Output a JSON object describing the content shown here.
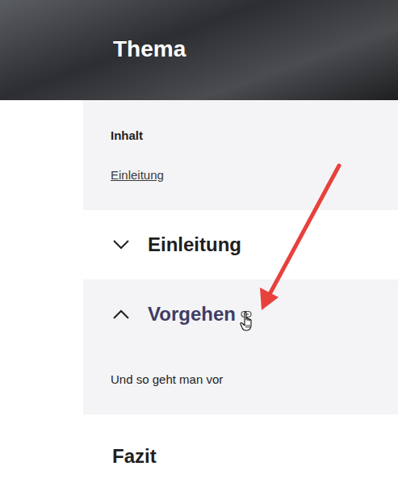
{
  "header": {
    "title": "Thema"
  },
  "toc": {
    "title": "Inhalt",
    "items": [
      {
        "label": "Einleitung"
      }
    ]
  },
  "sections": [
    {
      "title": "Einleitung",
      "kind": "accordion",
      "expanded": false,
      "hovered": false,
      "body": ""
    },
    {
      "title": "Vorgehen",
      "kind": "accordion",
      "expanded": true,
      "hovered": true,
      "body": "Und so geht man vor"
    },
    {
      "title": "Fazit",
      "kind": "heading",
      "expanded": false,
      "hovered": false,
      "body": ""
    }
  ]
}
